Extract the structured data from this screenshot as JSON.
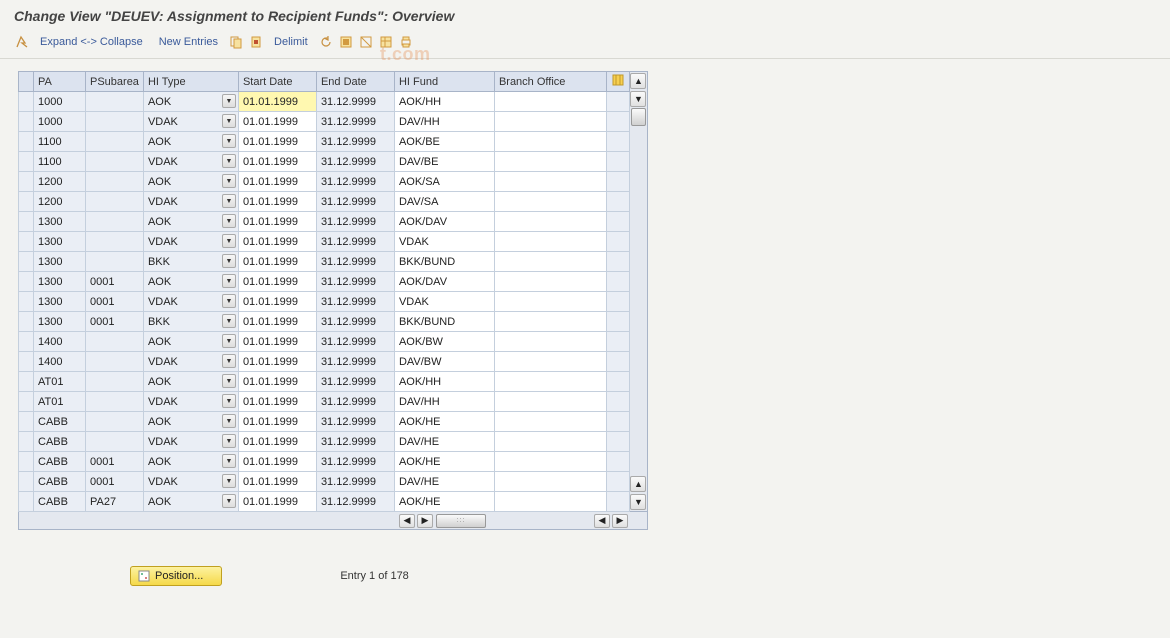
{
  "header": {
    "title": "Change View \"DEUEV: Assignment to Recipient Funds\": Overview"
  },
  "toolbar": {
    "expand_collapse": "Expand <-> Collapse",
    "new_entries": "New Entries",
    "delimit": "Delimit"
  },
  "watermark": "t.com",
  "columns": {
    "pa": "PA",
    "psubarea": "PSubarea",
    "hi_type": "HI Type",
    "start_date": "Start Date",
    "end_date": "End Date",
    "hi_fund": "HI Fund",
    "branch_office": "Branch Office"
  },
  "rows": [
    {
      "pa": "1000",
      "ps": "",
      "hit": "AOK",
      "sd": "01.01.1999",
      "ed": "31.12.9999",
      "hf": "AOK/HH",
      "bo": ""
    },
    {
      "pa": "1000",
      "ps": "",
      "hit": "VDAK",
      "sd": "01.01.1999",
      "ed": "31.12.9999",
      "hf": "DAV/HH",
      "bo": ""
    },
    {
      "pa": "1100",
      "ps": "",
      "hit": "AOK",
      "sd": "01.01.1999",
      "ed": "31.12.9999",
      "hf": "AOK/BE",
      "bo": ""
    },
    {
      "pa": "1100",
      "ps": "",
      "hit": "VDAK",
      "sd": "01.01.1999",
      "ed": "31.12.9999",
      "hf": "DAV/BE",
      "bo": ""
    },
    {
      "pa": "1200",
      "ps": "",
      "hit": "AOK",
      "sd": "01.01.1999",
      "ed": "31.12.9999",
      "hf": "AOK/SA",
      "bo": ""
    },
    {
      "pa": "1200",
      "ps": "",
      "hit": "VDAK",
      "sd": "01.01.1999",
      "ed": "31.12.9999",
      "hf": "DAV/SA",
      "bo": ""
    },
    {
      "pa": "1300",
      "ps": "",
      "hit": "AOK",
      "sd": "01.01.1999",
      "ed": "31.12.9999",
      "hf": "AOK/DAV",
      "bo": ""
    },
    {
      "pa": "1300",
      "ps": "",
      "hit": "VDAK",
      "sd": "01.01.1999",
      "ed": "31.12.9999",
      "hf": "VDAK",
      "bo": ""
    },
    {
      "pa": "1300",
      "ps": "",
      "hit": "BKK",
      "sd": "01.01.1999",
      "ed": "31.12.9999",
      "hf": "BKK/BUND",
      "bo": ""
    },
    {
      "pa": "1300",
      "ps": "0001",
      "hit": "AOK",
      "sd": "01.01.1999",
      "ed": "31.12.9999",
      "hf": "AOK/DAV",
      "bo": ""
    },
    {
      "pa": "1300",
      "ps": "0001",
      "hit": "VDAK",
      "sd": "01.01.1999",
      "ed": "31.12.9999",
      "hf": "VDAK",
      "bo": ""
    },
    {
      "pa": "1300",
      "ps": "0001",
      "hit": "BKK",
      "sd": "01.01.1999",
      "ed": "31.12.9999",
      "hf": "BKK/BUND",
      "bo": ""
    },
    {
      "pa": "1400",
      "ps": "",
      "hit": "AOK",
      "sd": "01.01.1999",
      "ed": "31.12.9999",
      "hf": "AOK/BW",
      "bo": ""
    },
    {
      "pa": "1400",
      "ps": "",
      "hit": "VDAK",
      "sd": "01.01.1999",
      "ed": "31.12.9999",
      "hf": "DAV/BW",
      "bo": ""
    },
    {
      "pa": "AT01",
      "ps": "",
      "hit": "AOK",
      "sd": "01.01.1999",
      "ed": "31.12.9999",
      "hf": "AOK/HH",
      "bo": ""
    },
    {
      "pa": "AT01",
      "ps": "",
      "hit": "VDAK",
      "sd": "01.01.1999",
      "ed": "31.12.9999",
      "hf": "DAV/HH",
      "bo": ""
    },
    {
      "pa": "CABB",
      "ps": "",
      "hit": "AOK",
      "sd": "01.01.1999",
      "ed": "31.12.9999",
      "hf": "AOK/HE",
      "bo": ""
    },
    {
      "pa": "CABB",
      "ps": "",
      "hit": "VDAK",
      "sd": "01.01.1999",
      "ed": "31.12.9999",
      "hf": "DAV/HE",
      "bo": ""
    },
    {
      "pa": "CABB",
      "ps": "0001",
      "hit": "AOK",
      "sd": "01.01.1999",
      "ed": "31.12.9999",
      "hf": "AOK/HE",
      "bo": ""
    },
    {
      "pa": "CABB",
      "ps": "0001",
      "hit": "VDAK",
      "sd": "01.01.1999",
      "ed": "31.12.9999",
      "hf": "DAV/HE",
      "bo": ""
    },
    {
      "pa": "CABB",
      "ps": "PA27",
      "hit": "AOK",
      "sd": "01.01.1999",
      "ed": "31.12.9999",
      "hf": "AOK/HE",
      "bo": ""
    }
  ],
  "footer": {
    "position_label": "Position...",
    "entry_text": "Entry 1 of 178"
  }
}
